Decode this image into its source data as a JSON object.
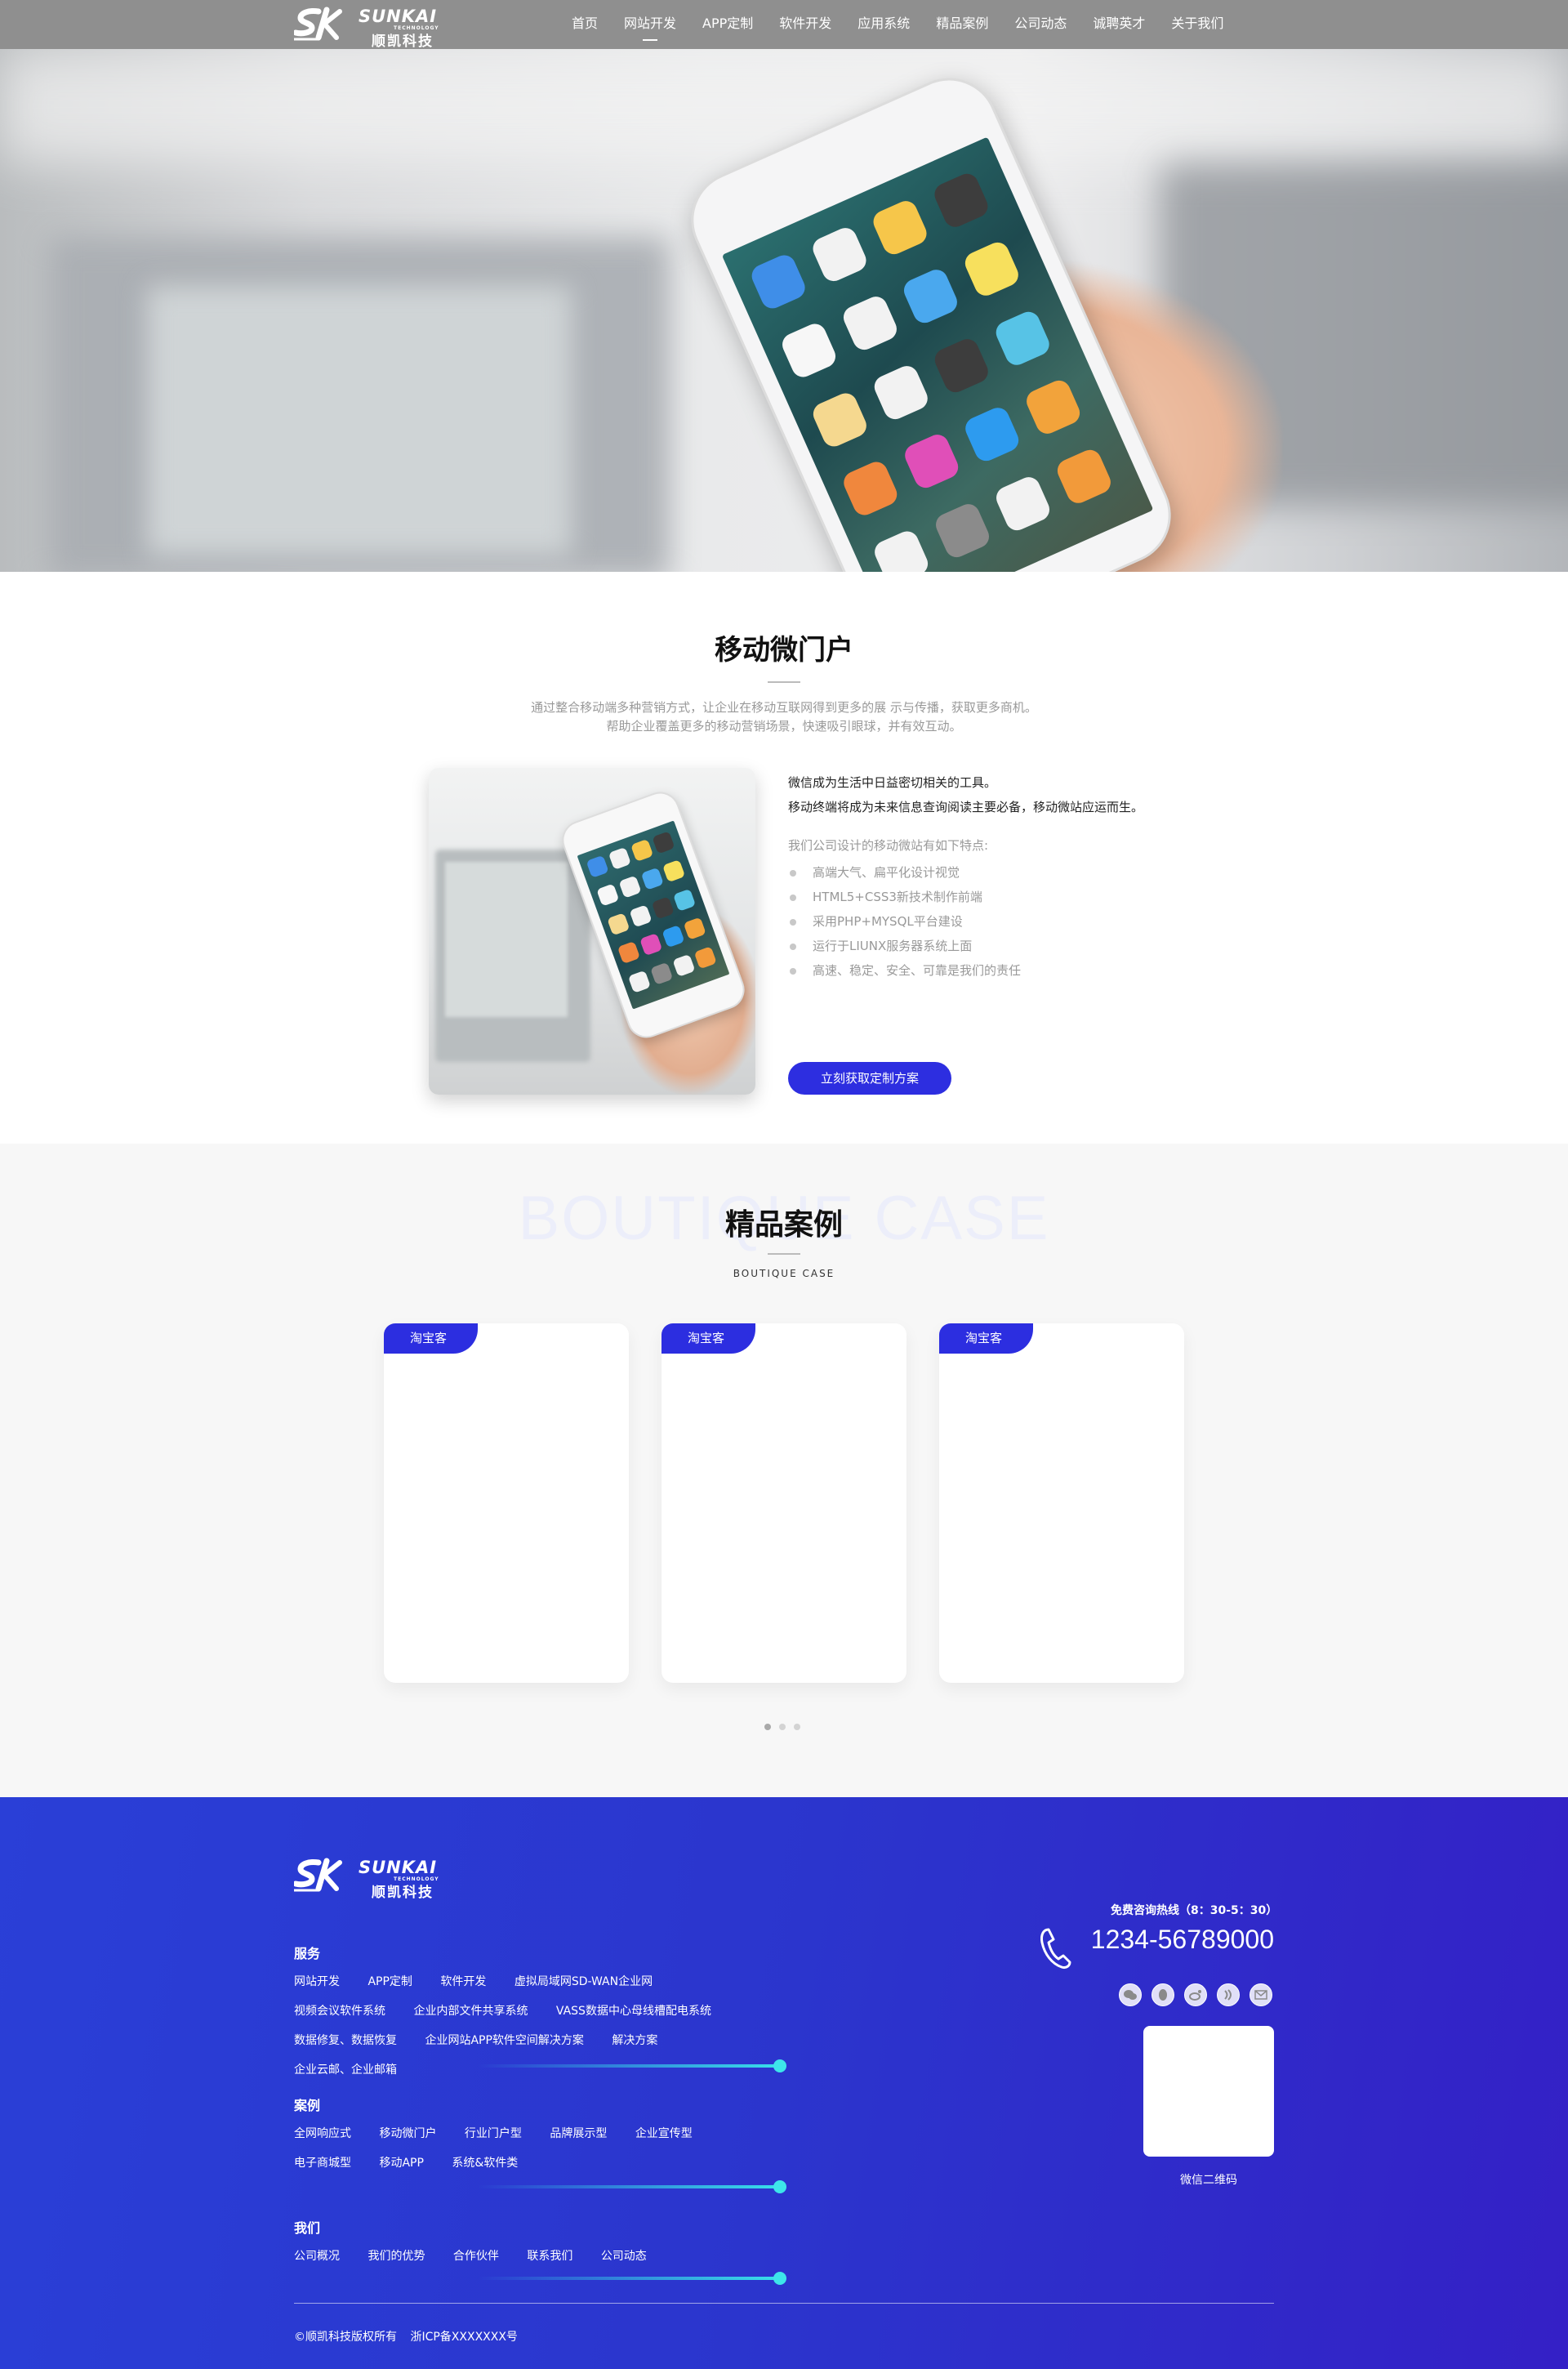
{
  "header": {
    "logo": {
      "en": "SUNKAI",
      "sub": "TECHNOLOGY",
      "cn": "顺凯科技"
    },
    "nav": [
      {
        "label": "首页"
      },
      {
        "label": "网站开发",
        "active": true
      },
      {
        "label": "APP定制"
      },
      {
        "label": "软件开发"
      },
      {
        "label": "应用系统"
      },
      {
        "label": "精品案例"
      },
      {
        "label": "公司动态"
      },
      {
        "label": "诚聘英才"
      },
      {
        "label": "关于我们"
      }
    ]
  },
  "intro": {
    "title": "移动微门户",
    "desc_line1": "通过整合移动端多种营销方式，让企业在移动互联网得到更多的展 示与传播，获取更多商机。",
    "desc_line2": "帮助企业覆盖更多的移动营销场景，快速吸引眼球，并有效互动。",
    "lead1": "微信成为生活中日益密切相关的工具。",
    "lead2": "移动终端将成为未来信息查询阅读主要必备，移动微站应运而生。",
    "features_title": "我们公司设计的移动微站有如下特点:",
    "features": [
      "高端大气、扁平化设计视觉",
      "HTML5+CSS3新技术制作前端",
      "采用PHP+MYSQL平台建设",
      "运行于LIUNX服务器系统上面",
      "高速、稳定、安全、可靠是我们的责任"
    ],
    "cta": "立刻获取定制方案"
  },
  "cases": {
    "bg_text": "BOUTIQUE CASE",
    "title": "精品案例",
    "subtitle": "BOUTIQUE CASE",
    "cards": [
      {
        "tag": "淘宝客"
      },
      {
        "tag": "淘宝客"
      },
      {
        "tag": "淘宝客"
      }
    ],
    "pagination_active": 0
  },
  "footer": {
    "groups": [
      {
        "title": "服务",
        "links": [
          "网站开发",
          "APP定制",
          "软件开发",
          "虚拟局域网SD-WAN企业网",
          "视频会议软件系统",
          "企业内部文件共享系统",
          "VASS数据中心母线槽配电系统",
          "数据修复、数据恢复",
          "企业网站APP软件空间解决方案",
          "解决方案",
          "企业云邮、企业邮箱"
        ]
      },
      {
        "title": "案例",
        "links": [
          "全网响应式",
          "移动微门户",
          "行业门户型",
          "品牌展示型",
          "企业宣传型",
          "电子商城型",
          "移动APP",
          "系统&软件类"
        ]
      },
      {
        "title": "我们",
        "links": [
          "公司概况",
          "我们的优势",
          "合作伙伴",
          "联系我们",
          "公司动态"
        ]
      }
    ],
    "hotline_label": "免费咨询热线（8：30-5：30）",
    "hotline": "1234-56789000",
    "social_icons": [
      "wechat-icon",
      "qq-icon",
      "weibo-icon",
      "audio-icon",
      "mail-icon"
    ],
    "qr_label": "微信二维码",
    "copyright": "©顺凯科技版权所有",
    "icp": "浙ICP备XXXXXXX号"
  },
  "colors": {
    "accent": "#2c2ee0",
    "footer_bg": "#2b35cd",
    "bar": "#38e1ea"
  }
}
